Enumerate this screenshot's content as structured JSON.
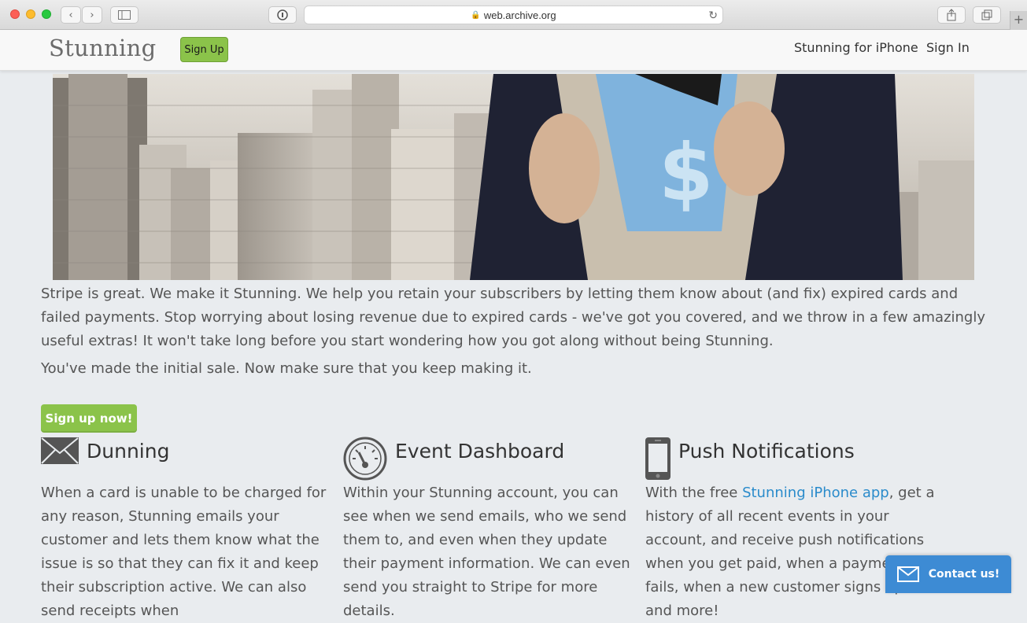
{
  "browser": {
    "url": "web.archive.org"
  },
  "nav": {
    "logo": "Stunning",
    "signup_label": "Sign Up",
    "links": [
      "Stunning for iPhone",
      "Sign In"
    ]
  },
  "hero": {
    "symbol": "$"
  },
  "intro": {
    "paragraph": "Stripe is great. We make it Stunning. We help you retain your subscribers by letting them know about (and fix) expired cards and failed payments. Stop worrying about losing revenue due to expired cards - we've got you covered, and we throw in a few amazingly useful extras! It won't take long before you start wondering how you got along without being Stunning.",
    "tagline": "You've made the initial sale. Now make sure that you keep making it.",
    "cta_label": "Sign up now!"
  },
  "features": [
    {
      "title": "Dunning",
      "icon": "envelope-icon",
      "body": "When a card is unable to be charged for any reason, Stunning emails your customer and lets them know what the issue is so that they can fix it and keep their subscription active. We can also send receipts when"
    },
    {
      "title": "Event Dashboard",
      "icon": "speedometer-icon",
      "body": "Within your Stunning account, you can see when we send emails, who we send them to, and even when they update their payment information. We can even send you straight to Stripe for more details."
    },
    {
      "title": "Push Notifications",
      "icon": "phone-icon",
      "body_before": "With the free ",
      "body_link": "Stunning iPhone app",
      "body_after": ", get a history of all recent events in your account, and receive push notifications when you get paid, when a payment fails, when a new customer signs up, and more!"
    }
  ],
  "contact": {
    "label": "Contact us!"
  },
  "colors": {
    "accent_green": "#8bc34a",
    "link_blue": "#2a8bcb",
    "contact_blue": "#3d8bd4",
    "page_bg": "#e9ecef"
  }
}
